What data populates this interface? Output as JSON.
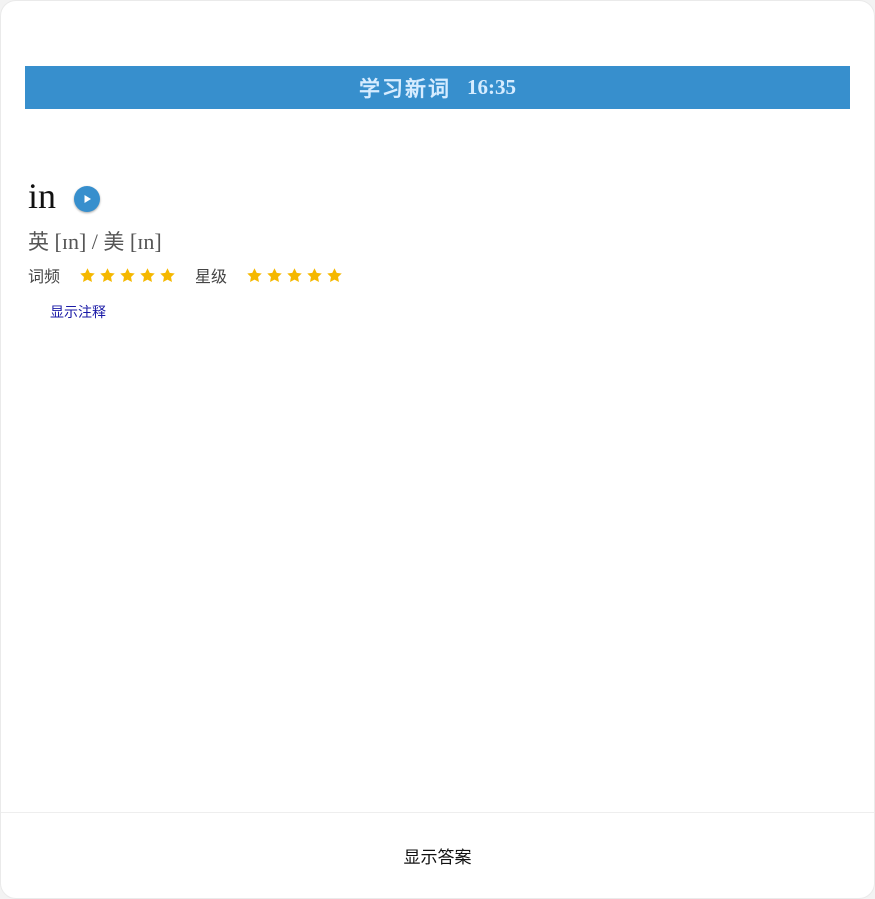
{
  "header": {
    "title": "学习新词",
    "time": "16:35"
  },
  "word": {
    "text": "in",
    "play_icon": "play-icon"
  },
  "phonetic": {
    "uk_label": "英",
    "uk_ipa": "[ɪn]",
    "separator": "/",
    "us_label": "美",
    "us_ipa": "[ɪn]"
  },
  "ratings": {
    "frequency_label": "词频",
    "frequency_stars": 5,
    "star_level_label": "星级",
    "star_level_stars": 5,
    "star_color": "#f5b800"
  },
  "actions": {
    "show_note": "显示注释",
    "show_answer": "显示答案"
  },
  "colors": {
    "accent": "#378fcd"
  }
}
